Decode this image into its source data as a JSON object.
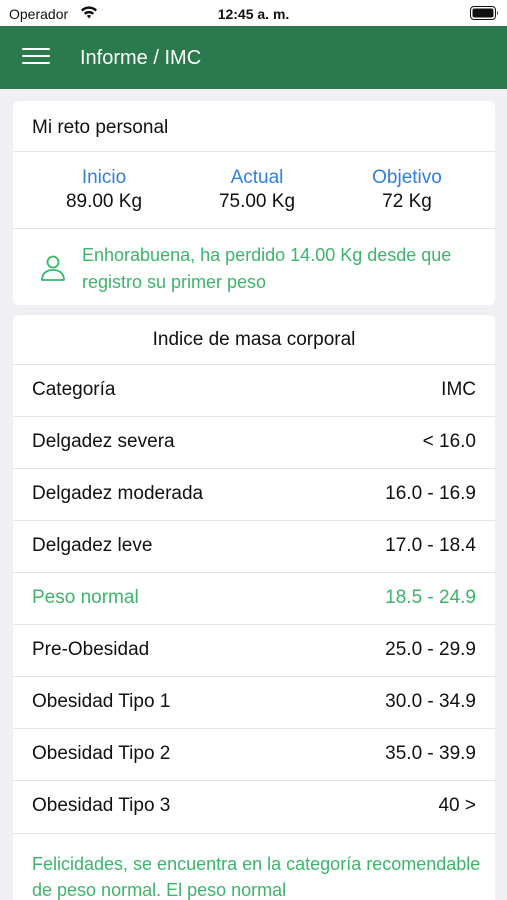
{
  "status_bar": {
    "carrier": "Operador",
    "time": "12:45 a. m."
  },
  "app_bar": {
    "title": "Informe / IMC",
    "menu_icon": "hamburger-menu-icon"
  },
  "challenge": {
    "title": "Mi reto personal",
    "stats": [
      {
        "label": "Inicio",
        "value": "89.00 Kg"
      },
      {
        "label": "Actual",
        "value": "75.00 Kg"
      },
      {
        "label": "Objetivo",
        "value": "72 Kg"
      }
    ],
    "message": "Enhorabuena, ha perdido 14.00 Kg desde que registro su primer peso",
    "message_icon": "person-icon"
  },
  "bmi": {
    "title": "Indice de masa corporal",
    "header": {
      "category": "Categoría",
      "value": "IMC"
    },
    "rows": [
      {
        "category": "Delgadez severa",
        "value": "< 16.0"
      },
      {
        "category": "Delgadez moderada",
        "value": "16.0 - 16.9"
      },
      {
        "category": "Delgadez leve",
        "value": "17.0 - 18.4"
      },
      {
        "category": "Peso normal",
        "value": "18.5 - 24.9"
      },
      {
        "category": "Pre-Obesidad",
        "value": "25.0 - 29.9"
      },
      {
        "category": "Obesidad Tipo 1",
        "value": "30.0 - 34.9"
      },
      {
        "category": "Obesidad Tipo 2",
        "value": "35.0 - 39.9"
      },
      {
        "category": "Obesidad Tipo 3",
        "value": "40 >"
      }
    ],
    "footer": "Felicidades, se encuentra en la categoría recomendable de peso normal. El peso normal"
  },
  "colors": {
    "app_bar": "#2a7a4d",
    "accent_blue": "#2f7fdb",
    "success_green": "#3cb46a",
    "background": "#efeff4"
  }
}
